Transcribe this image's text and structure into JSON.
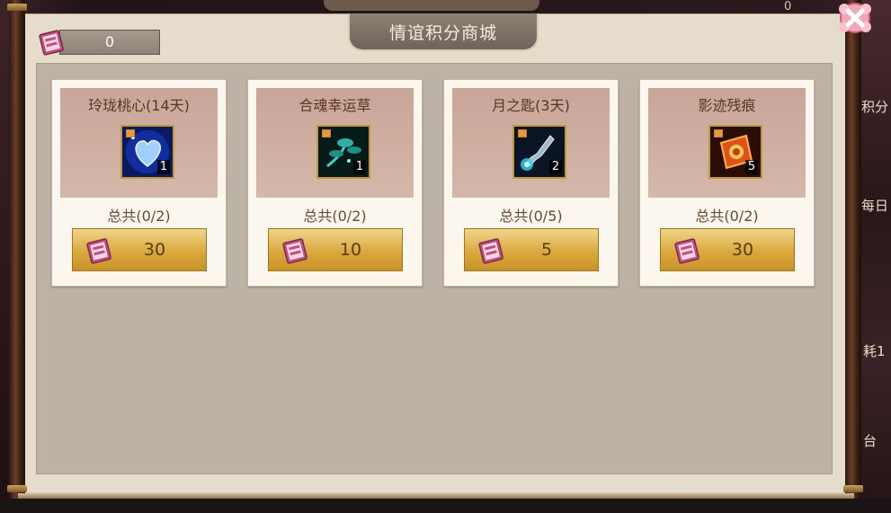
{
  "window": {
    "title": "情谊积分商城"
  },
  "currency": {
    "icon": "xiayi-points-icon",
    "value": "0"
  },
  "close_icon": "close-x-icon",
  "background_fragments": [
    "0",
    "积分",
    "每日",
    "耗1",
    "台"
  ],
  "items": [
    {
      "name": "玲珑桃心(14天)",
      "icon": "blue-heart-icon",
      "count": "1",
      "total": "总共(0/2)",
      "price": "30"
    },
    {
      "name": "合魂幸运草",
      "icon": "teal-clover-icon",
      "count": "1",
      "total": "总共(0/2)",
      "price": "10"
    },
    {
      "name": "月之匙(3天)",
      "icon": "moon-key-icon",
      "count": "2",
      "total": "总共(0/5)",
      "price": "5"
    },
    {
      "name": "影迹残痕",
      "icon": "shadow-trace-icon",
      "count": "5",
      "total": "总共(0/2)",
      "price": "30"
    }
  ],
  "colors": {
    "button_gold": "#d9a93e",
    "card_header": "#c9a598",
    "panel": "#e6dccb"
  }
}
